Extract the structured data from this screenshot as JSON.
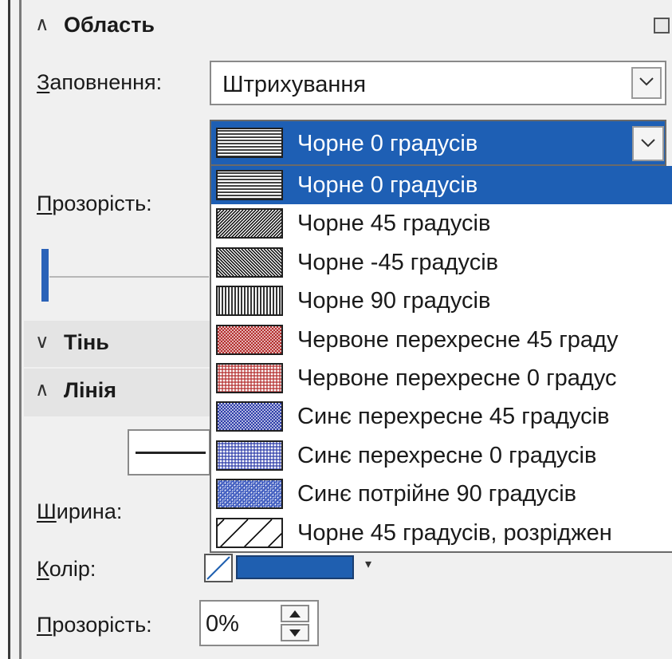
{
  "sections": {
    "area": {
      "title": "Область",
      "expanded": true
    },
    "shadow": {
      "title": "Тінь",
      "expanded": false
    },
    "line": {
      "title": "Лінія",
      "expanded": true
    }
  },
  "area": {
    "fill_label_u": "З",
    "fill_label_rest": "аповнення:",
    "fill_value": "Штрихування",
    "transparency_label_u": "П",
    "transparency_label_rest": "розорість:"
  },
  "hatch_dropdown": {
    "selected": "Чорне 0 градусів",
    "options": [
      {
        "label": "Чорне 0 градусів",
        "selected": true,
        "pattern": "horizontal",
        "color": "#000000"
      },
      {
        "label": "Чорне 45 градусів",
        "pattern": "diag-45",
        "color": "#000000"
      },
      {
        "label": "Чорне -45 градусів",
        "pattern": "diag-minus-45",
        "color": "#000000"
      },
      {
        "label": "Чорне 90 градусів",
        "pattern": "vertical",
        "color": "#000000"
      },
      {
        "label": "Червоне перехресне 45 граду",
        "pattern": "cross-45",
        "color": "#b22a2a"
      },
      {
        "label": "Червоне перехресне 0 градус",
        "pattern": "cross-0",
        "color": "#b22a2a"
      },
      {
        "label": "Синє перехресне 45 градусів",
        "pattern": "cross-45",
        "color": "#2a3aa8"
      },
      {
        "label": "Синє перехресне 0 градусів",
        "pattern": "cross-0",
        "color": "#2a3aa8"
      },
      {
        "label": "Синє потрійне 90 градусів",
        "pattern": "triple",
        "color": "#2a4ab8"
      },
      {
        "label": "Чорне 45 градусів, розріджен",
        "pattern": "sparse-45",
        "color": "#000000"
      }
    ]
  },
  "line": {
    "width_label_u": "Ш",
    "width_label_rest": "ирина:",
    "color_label_u": "К",
    "color_label_rest": "олір:",
    "line_color": "#1f5fb0",
    "transparency_label_u": "П",
    "transparency_label_rest": "розорість:",
    "transparency_value": "0%"
  },
  "colors": {
    "selection": "#1e5fb4",
    "panel": "#f0f0f0"
  }
}
